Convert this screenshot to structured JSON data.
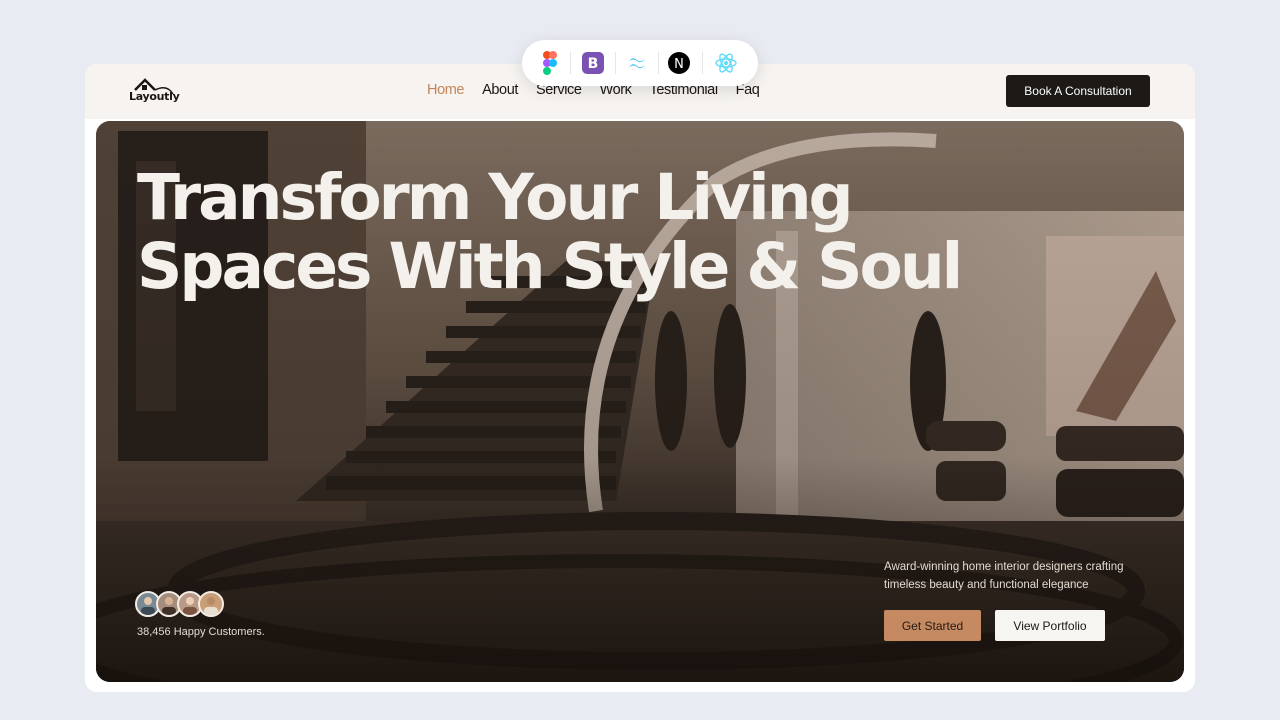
{
  "brand": {
    "logo_text": "Layoutly"
  },
  "nav": {
    "items": [
      {
        "label": "Home",
        "active": true
      },
      {
        "label": "About",
        "active": false
      },
      {
        "label": "Service",
        "active": false
      },
      {
        "label": "Work",
        "active": false
      },
      {
        "label": "Testimonial",
        "active": false
      },
      {
        "label": "Faq",
        "active": false
      }
    ],
    "cta_label": "Book A Consultation"
  },
  "hero": {
    "headline_line1": "Transform Your Living",
    "headline_line2": "Spaces With Style & Soul",
    "tagline_line1": "Award-winning home interior designers crafting",
    "tagline_line2": "timeless beauty and functional elegance",
    "primary_button": "Get Started",
    "secondary_button": "View Portfolio",
    "customers_text": "38,456 Happy Customers."
  },
  "toolbar": {
    "icons": [
      "figma-icon",
      "bootstrap-icon",
      "tailwind-icon",
      "nextjs-icon",
      "react-icon"
    ]
  },
  "colors": {
    "accent": "#c4855a",
    "dark": "#1d1916",
    "page_bg": "#e8ebf1"
  }
}
